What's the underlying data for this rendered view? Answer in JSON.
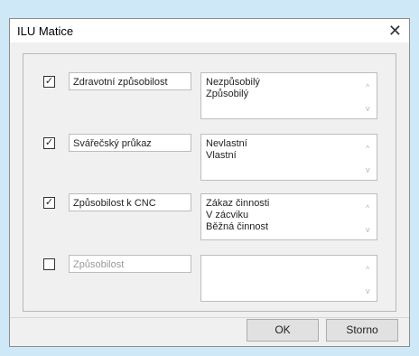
{
  "window": {
    "title": "ILU Matice",
    "close_glyph": "✕"
  },
  "rows": [
    {
      "checked": true,
      "check_glyph": "✓",
      "label": "Zdravotní způsobilost",
      "items": [
        "Nezpůsobilý",
        "Způsobilý"
      ]
    },
    {
      "checked": true,
      "check_glyph": "✓",
      "label": "Svářečský průkaz",
      "items": [
        "Nevlastní",
        "Vlastní"
      ]
    },
    {
      "checked": true,
      "check_glyph": "✓",
      "label": "Způsobilost k CNC",
      "items": [
        "Zákaz činnosti",
        "V zácviku",
        "Běžná činnost"
      ]
    },
    {
      "checked": false,
      "check_glyph": "",
      "label": "Způsobilost",
      "items": []
    }
  ],
  "buttons": {
    "ok": "OK",
    "cancel": "Storno"
  },
  "icons": {
    "scroll_up": "^",
    "scroll_down": "v"
  }
}
